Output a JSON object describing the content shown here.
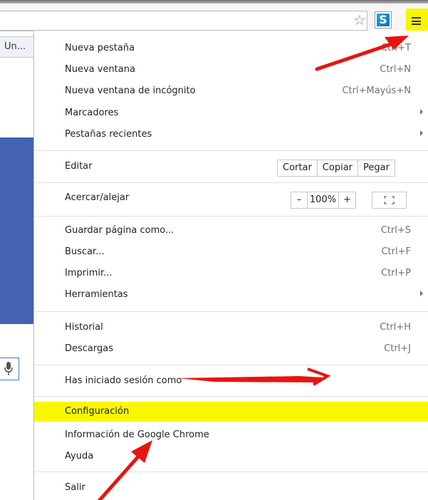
{
  "toolbar": {
    "star_icon": "star-icon",
    "extension_letter": "S",
    "menu_icon": "hamburger-menu-icon",
    "highlight_color": "#f8f400"
  },
  "page": {
    "tab_text": "Un..."
  },
  "menu": {
    "new_tab": {
      "label": "Nueva pestaña",
      "shortcut": "Ctrl+T"
    },
    "new_window": {
      "label": "Nueva ventana",
      "shortcut": "Ctrl+N"
    },
    "incognito": {
      "label": "Nueva ventana de incógnito",
      "shortcut": "Ctrl+Mayús+N"
    },
    "bookmarks": {
      "label": "Marcadores"
    },
    "recent_tabs": {
      "label": "Pestañas recientes"
    },
    "edit": {
      "label": "Editar",
      "cut": "Cortar",
      "copy": "Copiar",
      "paste": "Pegar"
    },
    "zoom": {
      "label": "Acercar/alejar",
      "minus": "–",
      "value": "100%",
      "plus": "+"
    },
    "save_page": {
      "label": "Guardar página como...",
      "shortcut": "Ctrl+S"
    },
    "find": {
      "label": "Buscar...",
      "shortcut": "Ctrl+F"
    },
    "print": {
      "label": "Imprimir...",
      "shortcut": "Ctrl+P"
    },
    "tools": {
      "label": "Herramientas"
    },
    "history": {
      "label": "Historial",
      "shortcut": "Ctrl+H"
    },
    "downloads": {
      "label": "Descargas",
      "shortcut": "Ctrl+J"
    },
    "signed_in": {
      "label": "Has iniciado sesión como"
    },
    "settings": {
      "label": "Configuración"
    },
    "about": {
      "label": "Información de Google Chrome"
    },
    "help": {
      "label": "Ayuda"
    },
    "exit": {
      "label": "Salir"
    }
  },
  "colors": {
    "highlight": "#f9f700",
    "annotation_arrow": "#e8140f",
    "page_blue": "#4463b0"
  }
}
